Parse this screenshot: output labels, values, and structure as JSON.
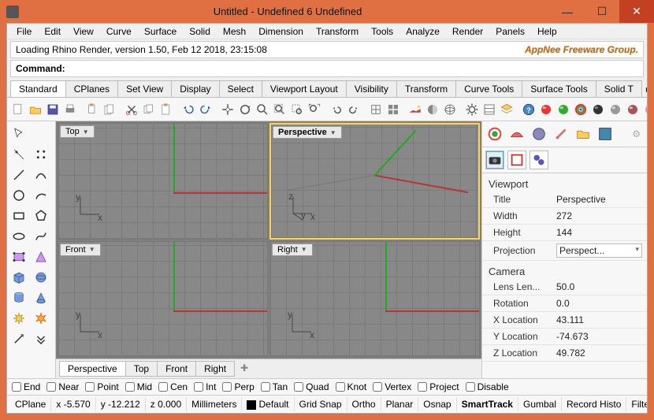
{
  "title": "Untitled - Undefined 6 Undefined",
  "menubar": [
    "File",
    "Edit",
    "View",
    "Curve",
    "Surface",
    "Solid",
    "Mesh",
    "Dimension",
    "Transform",
    "Tools",
    "Analyze",
    "Render",
    "Panels",
    "Help"
  ],
  "info_line": "Loading Rhino Render, version 1.50, Feb 12 2018, 23:15:08",
  "brand": "AppNee Freeware Group.",
  "command_prompt": "Command:",
  "tabs": [
    "Standard",
    "CPlanes",
    "Set View",
    "Display",
    "Select",
    "Viewport Layout",
    "Visibility",
    "Transform",
    "Curve Tools",
    "Surface Tools",
    "Solid T"
  ],
  "active_tab": 0,
  "viewports": [
    {
      "label": "Top",
      "active": false
    },
    {
      "label": "Perspective",
      "active": true
    },
    {
      "label": "Front",
      "active": false
    },
    {
      "label": "Right",
      "active": false
    }
  ],
  "viewport_tabs": [
    "Perspective",
    "Top",
    "Front",
    "Right"
  ],
  "right_panel": {
    "sections": [
      {
        "title": "Viewport",
        "rows": [
          {
            "k": "Title",
            "v": "Perspective"
          },
          {
            "k": "Width",
            "v": "272"
          },
          {
            "k": "Height",
            "v": "144"
          },
          {
            "k": "Projection",
            "v": "Perspect...",
            "combo": true
          }
        ]
      },
      {
        "title": "Camera",
        "rows": [
          {
            "k": "Lens Len...",
            "v": "50.0"
          },
          {
            "k": "Rotation",
            "v": "0.0"
          },
          {
            "k": "X Location",
            "v": "43.111"
          },
          {
            "k": "Y Location",
            "v": "-74.673"
          },
          {
            "k": "Z Location",
            "v": "49.782"
          }
        ]
      }
    ]
  },
  "osnaps": [
    "End",
    "Near",
    "Point",
    "Mid",
    "Cen",
    "Int",
    "Perp",
    "Tan",
    "Quad",
    "Knot",
    "Vertex",
    "Project",
    "Disable"
  ],
  "status": {
    "cplane": "CPlane",
    "x": "x -5.570",
    "y": "y -12.212",
    "z": "z 0.000",
    "units": "Millimeters",
    "layer": "Default",
    "toggles": [
      "Grid Snap",
      "Ortho",
      "Planar",
      "Osnap",
      "SmartTrack",
      "Gumbal",
      "Record Histo",
      "Filter"
    ],
    "bold_toggle": "SmartTrack"
  }
}
